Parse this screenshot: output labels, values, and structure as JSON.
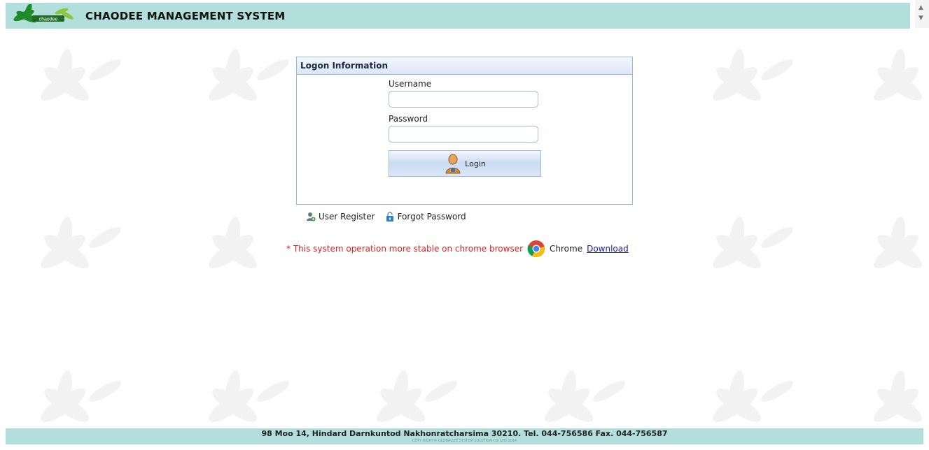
{
  "header": {
    "app_title": "CHAODEE MANAGEMENT SYSTEM",
    "logo_text": "chaodee"
  },
  "login_panel": {
    "title": "Logon Information",
    "username_label": "Username",
    "username_value": "",
    "password_label": "Password",
    "password_value": "",
    "login_label": "Login"
  },
  "links": {
    "register_label": "User Register",
    "forgot_label": "Forgot Password"
  },
  "notice": {
    "message": "* This system operation more stable on chrome browser",
    "browser_name": "Chrome",
    "download_label": "Download"
  },
  "footer": {
    "address": "98 Moo 14, Hindard Darnkuntod Nakhonratcharsima 30210. Tel. 044-756586 Fax. 044-756587",
    "copyright": "COPY RIGHT© GLOBALIZE SYSTEM SOLUTION CO.,LTD 2014"
  },
  "colors": {
    "header_bg": "#b2dfdb",
    "panel_border": "#9cb8d6",
    "notice_red": "#e0201e",
    "link_blue": "#1a1ab8"
  }
}
